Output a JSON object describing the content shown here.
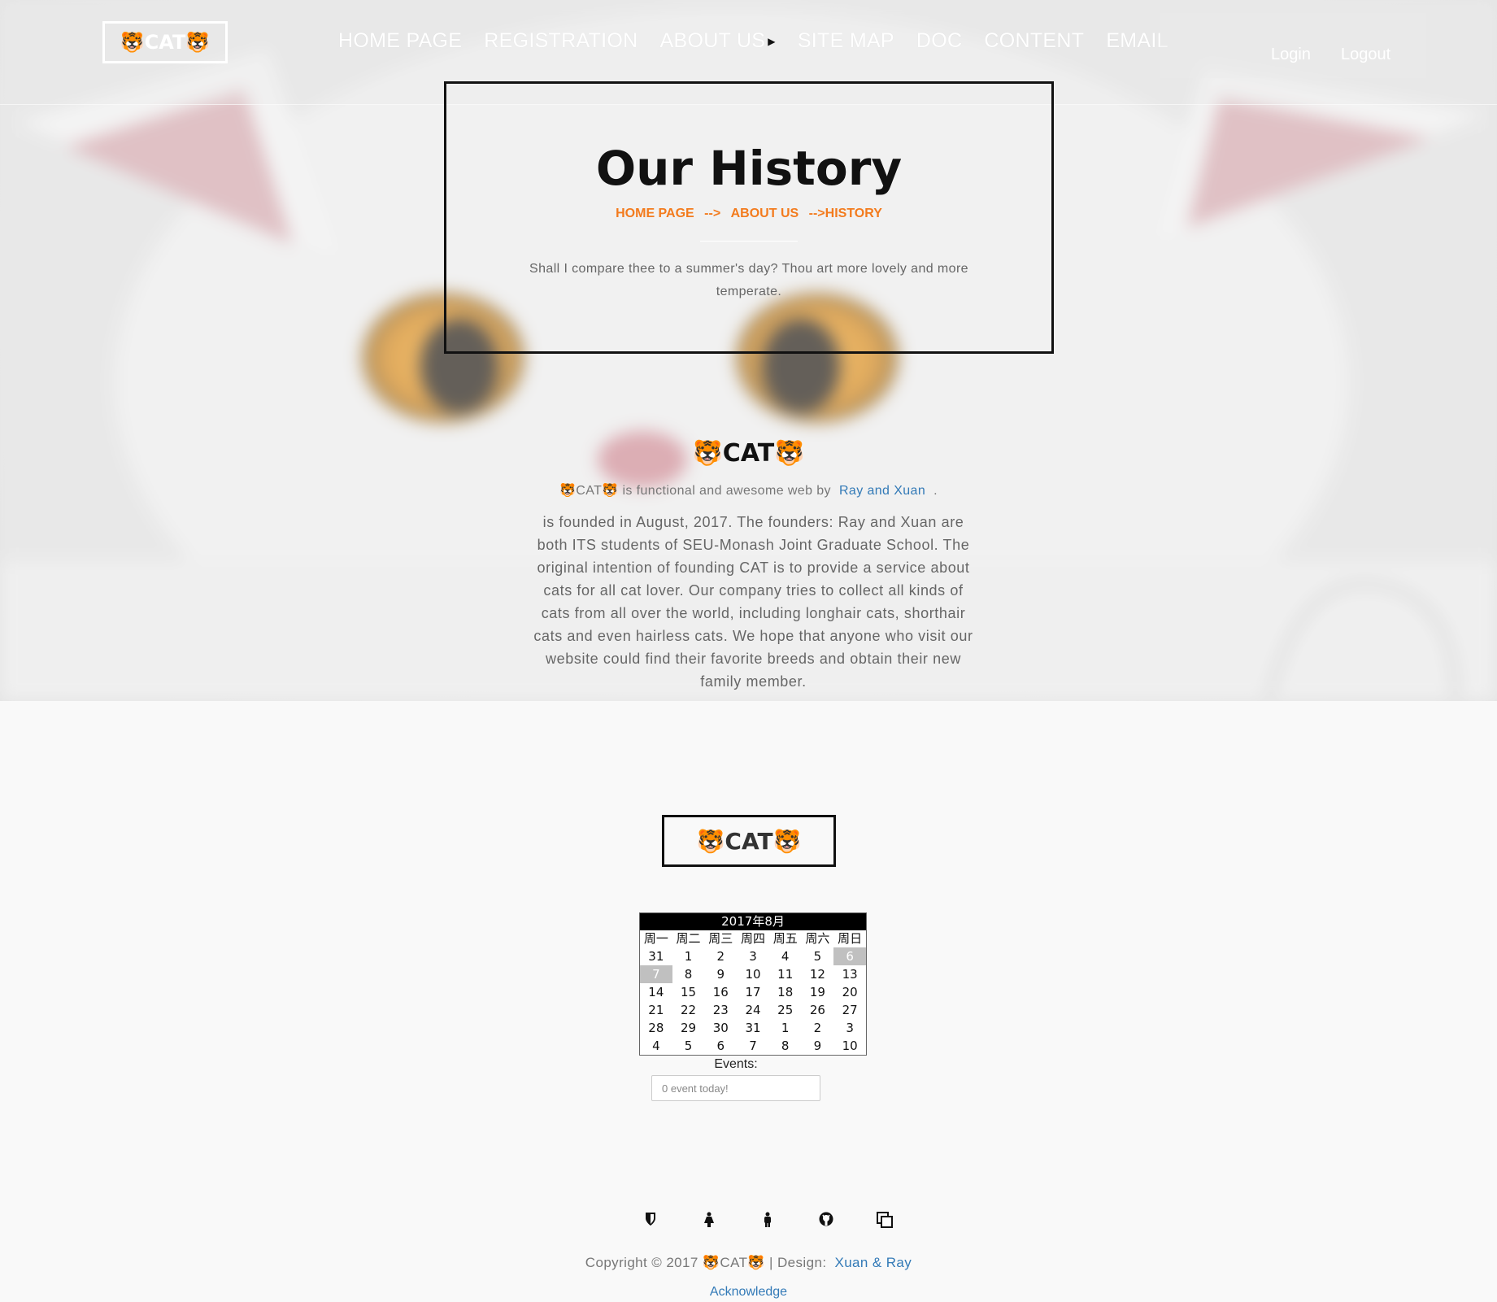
{
  "nav": {
    "brand": "🐯CAT🐯",
    "links": [
      "HOME PAGE",
      "REGISTRATION",
      "ABOUT US",
      "SITE MAP",
      "DOC",
      "CONTENT",
      "EMAIL"
    ],
    "login": "Login",
    "logout": "Logout"
  },
  "history": {
    "title": "Our History",
    "breadcrumb": [
      "HOME PAGE",
      "-->",
      "ABOUT US",
      "-->HISTORY"
    ],
    "quote": "Shall I compare thee to a summer's day? Thou art more lovely and more temperate."
  },
  "about": {
    "title": "🐯CAT🐯",
    "subtitle_prefix": "🐯CAT🐯 is functional and awesome web by",
    "subtitle_link": "Ray and Xuan",
    "subtitle_suffix": ".",
    "body": "is founded in August, 2017. The founders: Ray and Xuan are both ITS students of SEU-Monash Joint Graduate School. The original intention of founding CAT is to provide a service about cats for all cat lover. Our company tries to collect all kinds of cats from all over the world, including longhair cats, shorthair cats and even hairless cats. We hope that anyone who visit our website could find their favorite breeds and obtain their new family member."
  },
  "footer": {
    "brand": "🐯CAT🐯",
    "calendar": {
      "month": "2017年8月",
      "weekdays": [
        "周一",
        "周二",
        "周三",
        "周四",
        "周五",
        "周六",
        "周日"
      ],
      "weeks": [
        [
          "31",
          "1",
          "2",
          "3",
          "4",
          "5",
          "6"
        ],
        [
          "7",
          "8",
          "9",
          "10",
          "11",
          "12",
          "13"
        ],
        [
          "14",
          "15",
          "16",
          "17",
          "18",
          "19",
          "20"
        ],
        [
          "21",
          "22",
          "23",
          "24",
          "25",
          "26",
          "27"
        ],
        [
          "28",
          "29",
          "30",
          "31",
          "1",
          "2",
          "3"
        ],
        [
          "4",
          "5",
          "6",
          "7",
          "8",
          "9",
          "10"
        ]
      ],
      "highlighted": [
        "6",
        "7"
      ]
    },
    "events_label": "Events:",
    "events_value": "0 event today!",
    "social_icons": [
      "shield-icon",
      "female-icon",
      "male-icon",
      "github-icon",
      "copy-icon"
    ],
    "copyright_prefix": "Copyright © 2017 🐯CAT🐯 | Design:",
    "copyright_link": "Xuan & Ray",
    "acknowledge": "Acknowledge"
  }
}
